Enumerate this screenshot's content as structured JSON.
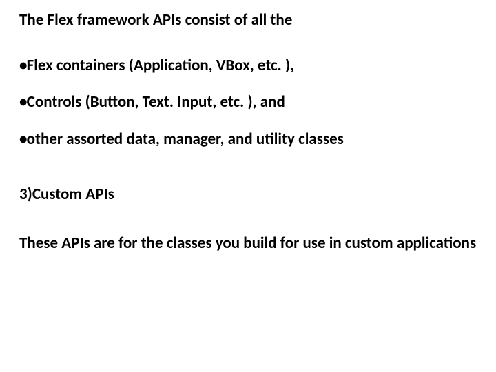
{
  "heading": "The Flex framework APIs consist of all the",
  "bullets": [
    "Flex containers (Application, VBox, etc. ),",
    "Controls (Button, Text. Input, etc. ), and",
    "other assorted data, manager, and utility classes"
  ],
  "subhead": "3)Custom APIs",
  "paragraph": "These APIs are for the classes you build for use in custom applications"
}
